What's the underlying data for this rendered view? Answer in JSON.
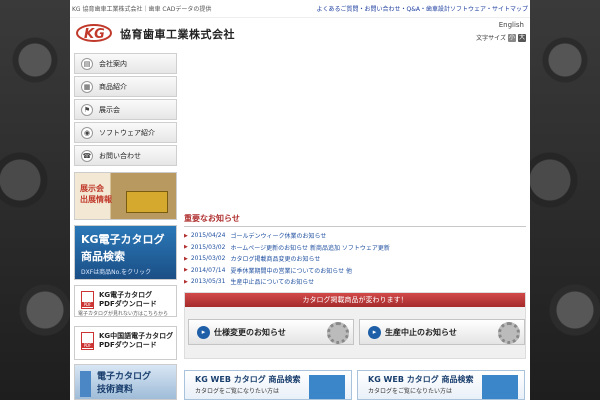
{
  "topbar": {
    "left": "KG 協育歯車工業株式会社｜歯車 CADデータの提供",
    "right": "よくあるご質問・お問い合わせ・Q&A・歯車設計ソフトウェア・サイトマップ"
  },
  "header": {
    "logo_text": "KG",
    "company": "協育歯車工業株式会社",
    "english": "English",
    "font_size_label": "文字サイズ",
    "font_small": "小",
    "font_large": "大"
  },
  "nav": {
    "items": [
      {
        "label": "会社案内",
        "icon": "book-icon"
      },
      {
        "label": "商品紹介",
        "icon": "box-icon"
      },
      {
        "label": "展示会",
        "icon": "flag-icon"
      },
      {
        "label": "ソフトウェア紹介",
        "icon": "disc-icon"
      },
      {
        "label": "お問い合わせ",
        "icon": "phone-icon"
      }
    ]
  },
  "banners": {
    "exhibit_line1": "展示会",
    "exhibit_line2": "出展情報",
    "kgcat_line1": "KG電子カタログ",
    "kgcat_line2": "商品検索",
    "kgcat_line3": "DXFは商品No.をクリック",
    "pdf1_line1": "KG電子カタログ",
    "pdf1_line2": "PDFダウンロード",
    "pdf1_note": "電子カタログが見れない方はこちらから",
    "pdf2_line1": "KG中国語電子カタログ",
    "pdf2_line2": "PDFダウンロード",
    "tech_line1": "電子カタログ",
    "tech_line2": "技術資料"
  },
  "news": {
    "title": "重要なお知らせ",
    "items": [
      {
        "date": "2015/04/24",
        "text": "ゴールデンウィーク休業のお知らせ"
      },
      {
        "date": "2015/03/02",
        "text": "ホームページ更新のお知らせ 新商品追加 ソフトウェア更新"
      },
      {
        "date": "2015/03/02",
        "text": "カタログ掲載商品変更のお知らせ"
      },
      {
        "date": "2014/07/14",
        "text": "夏季休業期間中の営業についてのお知らせ 他"
      },
      {
        "date": "2013/05/31",
        "text": "生産中止品についてのお知らせ"
      }
    ]
  },
  "catalog": {
    "header": "カタログ掲載商品が変わります！",
    "btn1": "仕様変更のお知らせ",
    "btn2": "生産中止のお知らせ"
  },
  "web": {
    "title": "KG WEB カタログ 商品検索",
    "sub": "カタログをご覧になりたい方は"
  }
}
